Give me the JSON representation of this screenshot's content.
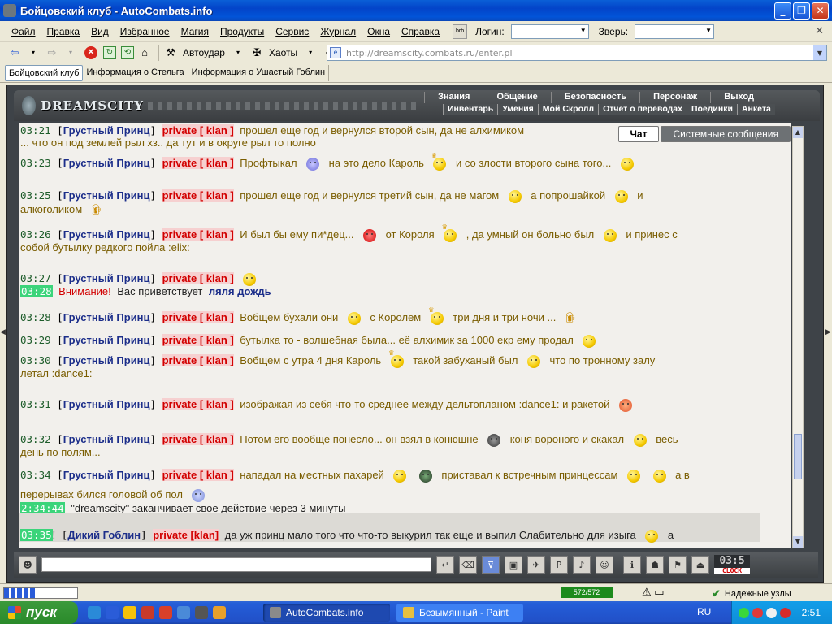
{
  "window": {
    "title": "Бойцовский клуб - AutoCombats.info"
  },
  "menu": {
    "items": [
      "Файл",
      "Правка",
      "Вид",
      "Избранное",
      "Магия",
      "Продукты",
      "Сервис",
      "Журнал",
      "Окна",
      "Справка"
    ],
    "login_label": "Логин:",
    "beast_label": "Зверь:"
  },
  "toolbar": {
    "autoudar": "Автоудар",
    "haoty": "Хаоты"
  },
  "address": {
    "url": "http://dreamscity.combats.ru/enter.pl"
  },
  "tabs": [
    "Бойцовский клуб",
    "Информация о Стельга",
    "Информация о Ушастый Гоблин"
  ],
  "game": {
    "logo": "DREAMSCITY",
    "nav_top": [
      "Знания",
      "Общение",
      "Безопасность",
      "Персонаж",
      "Выход"
    ],
    "nav_bottom": [
      "Инвентарь",
      "Умения",
      "Мой Скролл",
      "Отчет о переводах",
      "Поединки",
      "Анкета"
    ],
    "chat_tabs": {
      "chat": "Чат",
      "system": "Системные сообщения"
    }
  },
  "chat": {
    "lines": [
      {
        "time": "03:21",
        "name": "Грустный Принц",
        "priv": "private [ klan ]",
        "text": "прошел еще год и вернулся второй сын, да не алхимиком"
      },
      {
        "time": "",
        "name": "",
        "priv": "",
        "text": "... что он под землей рыл хз.. да тут и в округе рыл то полно"
      },
      {
        "time": "03:23",
        "name": "Грустный Принц",
        "priv": "private [ klan ]",
        "text": "Профтыкал"
      },
      {
        "time": "03:25",
        "name": "Грустный Принц",
        "priv": "private [ klan ]",
        "text": "прошел еще год и вернулся третий сын, да не магом"
      },
      {
        "time": "03:26",
        "name": "Грустный Принц",
        "priv": "private [ klan ]",
        "text": "И был бы ему пи*дец..."
      },
      {
        "time": "03:27",
        "name": "Грустный Принц",
        "priv": "private [ klan ]",
        "text": ""
      },
      {
        "time": "03:28",
        "name": "",
        "priv": "",
        "text": "Вас приветствует"
      },
      {
        "time": "03:28",
        "name": "Грустный Принц",
        "priv": "private [ klan ]",
        "text": "Вобщем бухали они"
      },
      {
        "time": "03:29",
        "name": "Грустный Принц",
        "priv": "private [ klan ]",
        "text": "бутылка то - волшебная была... её алхимик за 1000 екр ему продал"
      },
      {
        "time": "03:30",
        "name": "Грустный Принц",
        "priv": "private [ klan ]",
        "text": "Вобщем с утра 4 дня Кароль"
      },
      {
        "time": "03:31",
        "name": "Грустный Принц",
        "priv": "private [ klan ]",
        "text": "изображая из себя что-то среднее между дельтопланом :dance1: и ракетой"
      },
      {
        "time": "03:32",
        "name": "Грустный Принц",
        "priv": "private [ klan ]",
        "text": "Потом его вообще понесло... он взял в конюшне"
      },
      {
        "time": "03:34",
        "name": "Грустный Принц",
        "priv": "private [ klan ]",
        "text": "нападал на местных пахарей"
      },
      {
        "time": "2:34:44",
        "name": "",
        "priv": "",
        "text": "\"dreamscity\" заканчивает свое действие через 3 минуты"
      },
      {
        "time": "03:35",
        "name": "Дикий Гоблин",
        "priv": "private [klan]",
        "text": "да уж принц мало того что что-то выкурил так еще и выпил Слабительно для изыга"
      }
    ],
    "fragments": {
      "l3b": "на это дело Кароль",
      "l3c": "и со злости второго сына того...",
      "l4b": "а попрошайкой",
      "l4c": "и",
      "l4d": "алкоголиком",
      "l5b": "от Короля",
      "l5c": ", да умный он больно был",
      "l5d": "и принес с",
      "l5e": "собой бутылку редкого пойла :elix:",
      "attention": "Внимание!",
      "greet_name": "ляля дождь",
      "l7b": "с Королем",
      "l7c": "три дня и три ночи ...",
      "l9b": "такой забуханый был",
      "l9c": "что по тронному залу",
      "l9d": "летал :dance1:",
      "l11b": "коня вороного и скакал",
      "l11c": "весь",
      "l11d": "день по полям...",
      "l12b": "приставал к встречным принцессам",
      "l12c": "а в",
      "l12d": "перерывах бился головой об пол",
      "l14_excl": "!",
      "l14_end": "а"
    }
  },
  "bottom": {
    "clock": "03:5",
    "clock_label": "CLOCK"
  },
  "status": {
    "ram": "572/572",
    "safe": "Надежные узлы"
  },
  "taskbar": {
    "start": "пуск",
    "tasks": [
      "AutoCombats.info",
      "Безымянный - Paint"
    ],
    "lang": "RU",
    "time": "2:51"
  }
}
